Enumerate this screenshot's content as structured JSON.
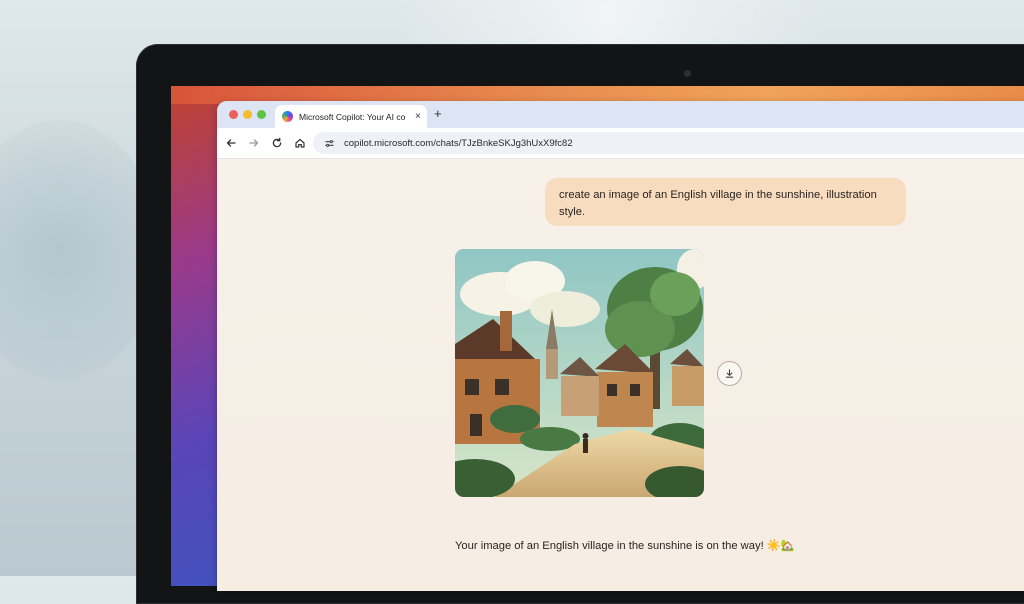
{
  "browser": {
    "tab_title": "Microsoft Copilot: Your AI co",
    "tab_close": "×",
    "new_tab": "+",
    "url": "copilot.microsoft.com/chats/TJzBnkeSKJg3hUxX9fc82",
    "nav_icons": [
      "back-arrow-icon",
      "forward-arrow-icon",
      "reload-icon",
      "home-icon",
      "site-settings-icon"
    ]
  },
  "chat": {
    "user_message": "create an image of an English village in the sunshine, illustration style.",
    "generated_image_subject": "",
    "assistant_message": "Your image of an English village in the sunshine is on the way! ☀️🏡"
  },
  "colors": {
    "user_bubble": "#f7dcc0",
    "content_bg": "#f7f1ea",
    "tab_bar": "#dde4f3"
  }
}
